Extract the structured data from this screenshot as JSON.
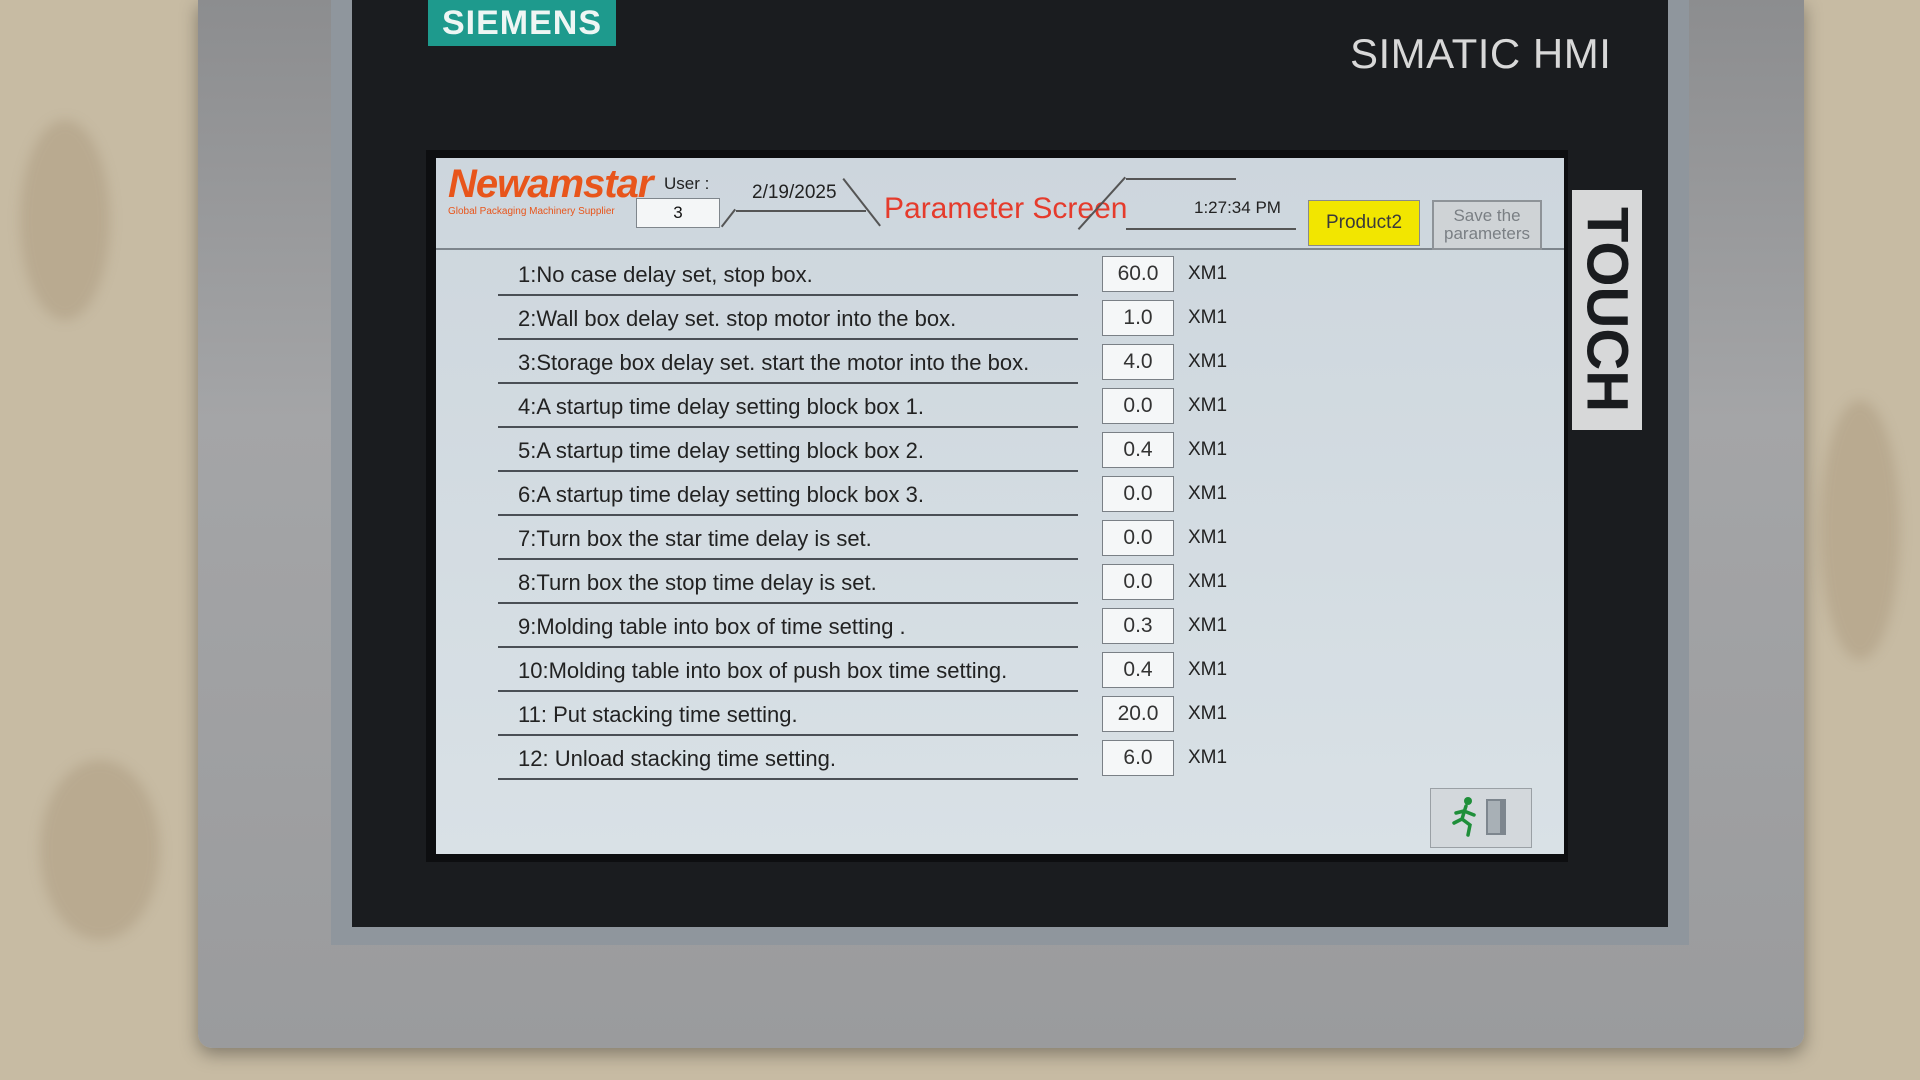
{
  "device": {
    "brand": "SIEMENS",
    "model": "SIMATIC HMI",
    "side_label": "TOUCH"
  },
  "header": {
    "company": "Newamstar",
    "company_tagline": "Global Packaging Machinery Supplier",
    "user_label": "User :",
    "user_value": "3",
    "date": "2/19/2025",
    "title": "Parameter Screen",
    "time": "1:27:34 PM",
    "product_button": "Product2",
    "save_button": "Save the parameters"
  },
  "parameters": [
    {
      "label": "1:No case delay set, stop box.",
      "value": "60.0",
      "unit": "XM1"
    },
    {
      "label": "2:Wall box delay set. stop motor into the box.",
      "value": "1.0",
      "unit": "XM1"
    },
    {
      "label": "3:Storage box delay set. start the motor into the box.",
      "value": "4.0",
      "unit": "XM1"
    },
    {
      "label": "4:A startup time delay setting block box 1.",
      "value": "0.0",
      "unit": "XM1"
    },
    {
      "label": "5:A startup time delay setting block box 2.",
      "value": "0.4",
      "unit": "XM1"
    },
    {
      "label": "6:A startup time delay setting block box 3.",
      "value": "0.0",
      "unit": "XM1"
    },
    {
      "label": "7:Turn box the star time delay is set.",
      "value": "0.0",
      "unit": "XM1"
    },
    {
      "label": "8:Turn box the stop time delay is set.",
      "value": "0.0",
      "unit": "XM1"
    },
    {
      "label": "9:Molding table into box of time setting .",
      "value": "0.3",
      "unit": "XM1"
    },
    {
      "label": "10:Molding table into box of push box time setting.",
      "value": "0.4",
      "unit": "XM1"
    },
    {
      "label": "11: Put stacking time setting.",
      "value": "20.0",
      "unit": "XM1"
    },
    {
      "label": "12: Unload stacking time setting.",
      "value": "6.0",
      "unit": "XM1"
    }
  ],
  "icons": {
    "exit": "exit-run-icon"
  },
  "colors": {
    "title": "#e53b2c",
    "product_button": "#f2e600",
    "brand_logo": "#1e9a8d",
    "company": "#e8551b"
  }
}
